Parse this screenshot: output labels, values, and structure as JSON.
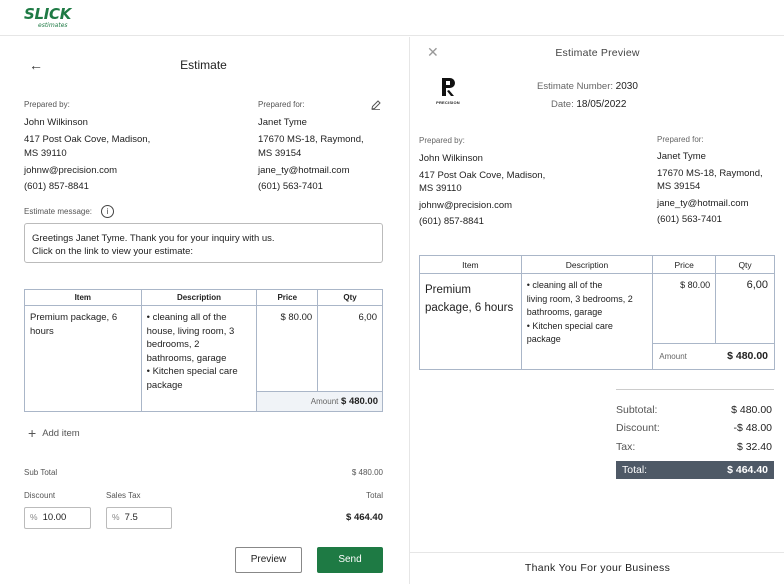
{
  "brand": {
    "name": "SLICK",
    "tagline": "estimates",
    "accent_color": "#1e7a44"
  },
  "form": {
    "title": "Estimate",
    "prepared_by_label": "Prepared by:",
    "prepared_for_label": "Prepared for:",
    "prepared_by": {
      "name": "John Wilkinson",
      "address1": "417 Post Oak Cove, Madison,",
      "address2": "MS 39110",
      "email": "johnw@precision.com",
      "phone": "(601) 857-8841"
    },
    "prepared_for": {
      "name": "Janet Tyme",
      "address1": "17670 MS-18, Raymond,",
      "address2": "MS 39154",
      "email": "jane_ty@hotmail.com",
      "phone": "(601) 563-7401"
    },
    "message_label": "Estimate message:",
    "message_line1": "Greetings Janet Tyme. Thank you for your inquiry with us.",
    "message_line2": "Click on the link to view your estimate:",
    "table": {
      "headers": [
        "Item",
        "Description",
        "Price",
        "Qty"
      ],
      "rows": [
        {
          "item": "Premium package, 6 hours",
          "description_lines": [
            "• cleaning all of the",
            "house,  living room, 3",
            "bedrooms, 2",
            "bathrooms, garage",
            "• Kitchen special care",
            "package"
          ],
          "price": "$ 80.00",
          "qty": "6,00"
        }
      ],
      "amount_label": "Amount",
      "amount_value": "$ 480.00"
    },
    "add_item_label": "Add item",
    "subtotal_label": "Sub Total",
    "subtotal_value": "$ 480.00",
    "discount_label": "Discount",
    "discount_prefix": "%",
    "discount_value": "10.00",
    "sales_tax_label": "Sales Tax",
    "sales_tax_prefix": "%",
    "sales_tax_value": "7.5",
    "total_label": "Total",
    "total_value": "$ 464.40",
    "preview_button": "Preview",
    "send_button": "Send"
  },
  "preview": {
    "title": "Estimate Preview",
    "company_logo_text": "PRECISION",
    "estimate_number_label": "Estimate Number:",
    "estimate_number": "2030",
    "date_label": "Date:",
    "date": "18/05/2022",
    "prepared_by_label": "Prepared by:",
    "prepared_for_label": "Prepared for:",
    "prepared_by": {
      "name": "John Wilkinson",
      "address1": "417 Post Oak Cove, Madison,",
      "address2": "MS 39110",
      "email": "johnw@precision.com",
      "phone": "(601) 857-8841"
    },
    "prepared_for": {
      "name": "Janet Tyme",
      "address1": "17670 MS-18, Raymond,",
      "address2": "MS 39154",
      "email": "jane_ty@hotmail.com",
      "phone": "(601) 563-7401"
    },
    "table": {
      "headers": [
        "Item",
        "Description",
        "Price",
        "Qty"
      ],
      "item_line1": "Premium",
      "item_line2": "package, 6 hours",
      "description_lines": [
        "• cleaning all of the",
        "living room, 3 bedrooms, 2",
        "bathrooms, garage",
        "• Kitchen special care",
        "package"
      ],
      "price": "$ 80.00",
      "qty": "6,00",
      "amount_label": "Amount",
      "amount_value": "$ 480.00"
    },
    "subtotal_label": "Subtotal:",
    "subtotal_value": "$ 480.00",
    "discount_label": "Discount:",
    "discount_value": "-$ 48.00",
    "tax_label": "Tax:",
    "tax_value": "$ 32.40",
    "total_label": "Total:",
    "total_value": "$ 464.40",
    "footer": "Thank You For your Business"
  },
  "icons": {
    "back": "arrow-left-icon",
    "edit": "pencil-icon",
    "info": "info-icon",
    "add": "plus-icon",
    "close": "close-icon"
  }
}
